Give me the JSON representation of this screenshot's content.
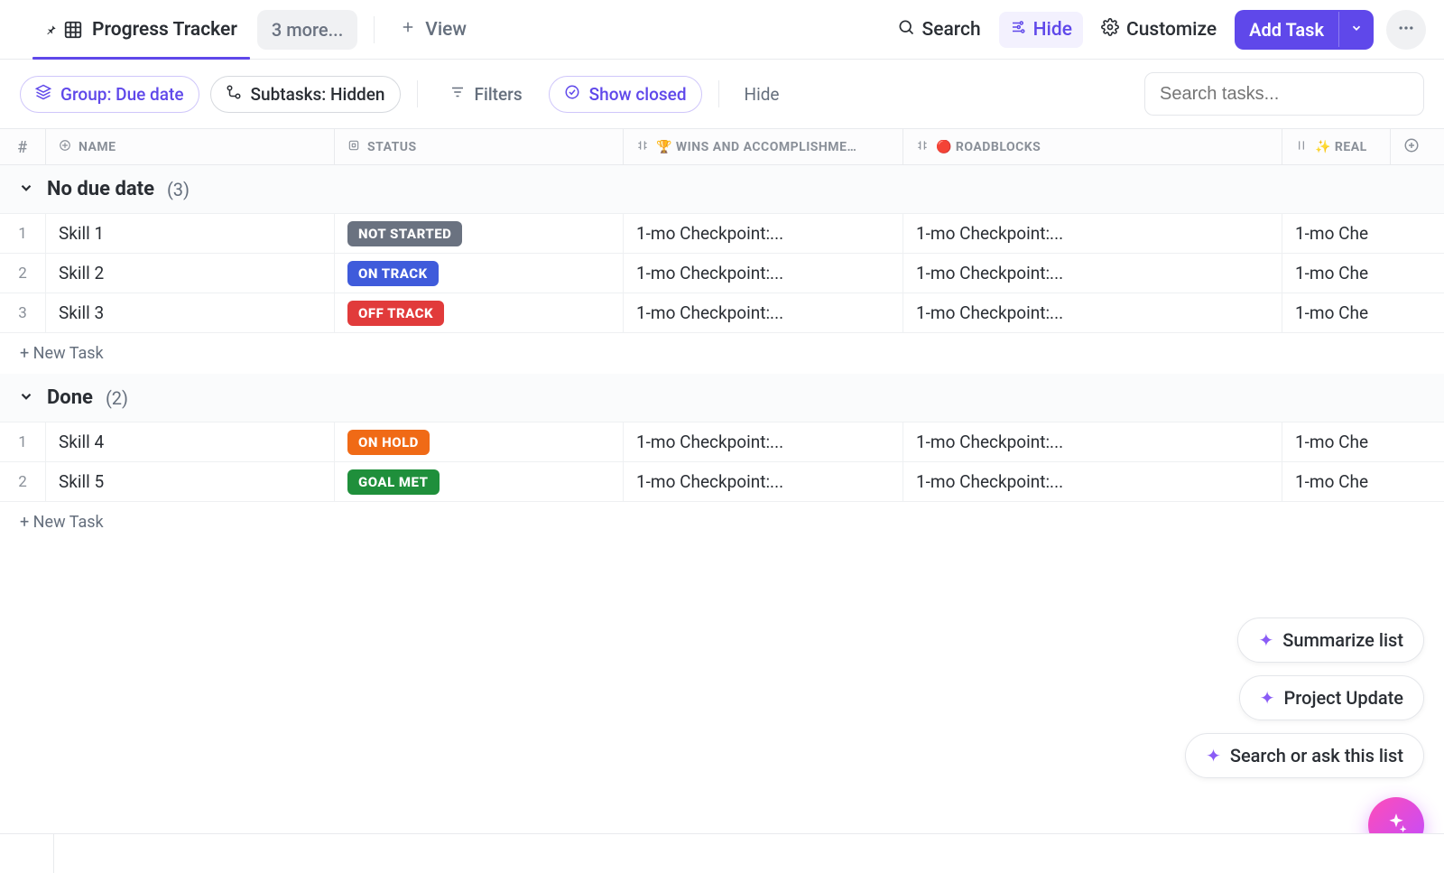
{
  "header": {
    "view_title": "Progress Tracker",
    "more_label": "3 more...",
    "add_view_label": "View",
    "search_label": "Search",
    "hide_label": "Hide",
    "customize_label": "Customize",
    "add_task_label": "Add Task"
  },
  "toolbar": {
    "group_label": "Group: Due date",
    "subtasks_label": "Subtasks: Hidden",
    "filters_label": "Filters",
    "show_closed_label": "Show closed",
    "hide_label": "Hide",
    "search_placeholder": "Search tasks..."
  },
  "columns": {
    "num": "#",
    "name": "NAME",
    "status": "STATUS",
    "wins": "🏆 WINS AND ACCOMPLISHME…",
    "roadblocks": "🔴 ROADBLOCKS",
    "realizations": "✨ REAL"
  },
  "groups": [
    {
      "name": "No due date",
      "count": "(3)",
      "rows": [
        {
          "n": "1",
          "name": "Skill 1",
          "status": "NOT STARTED",
          "status_color": "#6a7280",
          "wins": "1-mo Checkpoint:...",
          "blocks": "1-mo Checkpoint:...",
          "real": "1-mo Che"
        },
        {
          "n": "2",
          "name": "Skill 2",
          "status": "ON TRACK",
          "status_color": "#3f5bdb",
          "wins": "1-mo Checkpoint:...",
          "blocks": "1-mo Checkpoint:...",
          "real": "1-mo Che"
        },
        {
          "n": "3",
          "name": "Skill 3",
          "status": "OFF TRACK",
          "status_color": "#e13b3b",
          "wins": "1-mo Checkpoint:...",
          "blocks": "1-mo Checkpoint:...",
          "real": "1-mo Che"
        }
      ]
    },
    {
      "name": "Done",
      "count": "(2)",
      "rows": [
        {
          "n": "1",
          "name": "Skill 4",
          "status": "ON HOLD",
          "status_color": "#f06a16",
          "wins": "1-mo Checkpoint:...",
          "blocks": "1-mo Checkpoint:...",
          "real": "1-mo Che"
        },
        {
          "n": "2",
          "name": "Skill 5",
          "status": "GOAL MET",
          "status_color": "#1f8f3b",
          "wins": "1-mo Checkpoint:...",
          "blocks": "1-mo Checkpoint:...",
          "real": "1-mo Che"
        }
      ]
    }
  ],
  "new_task_label": "+ New Task",
  "ai": {
    "summarize": "Summarize list",
    "project_update": "Project Update",
    "search_ask": "Search or ask this list"
  }
}
